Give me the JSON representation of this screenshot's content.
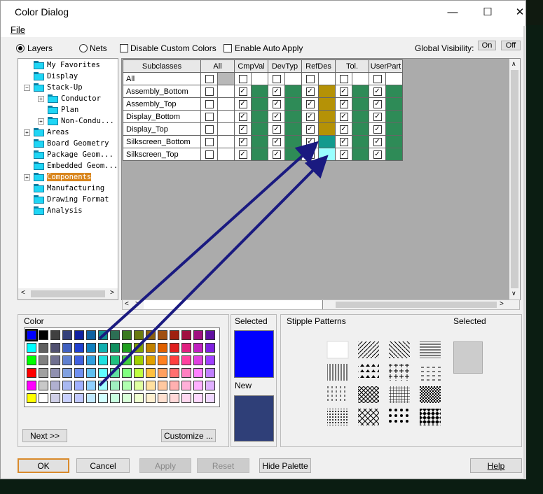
{
  "window": {
    "title": "Color Dialog",
    "minimize": "—",
    "maximize": "☐",
    "close": "✕"
  },
  "menu": {
    "file": "File"
  },
  "options": {
    "layers": "Layers",
    "nets": "Nets",
    "disable_custom": "Disable Custom Colors",
    "enable_auto": "Enable Auto Apply",
    "global_visibility": "Global Visibility:",
    "on": "On",
    "off": "Off"
  },
  "tree": [
    {
      "label": "My Favorites",
      "indent": 0,
      "expander": ""
    },
    {
      "label": "Display",
      "indent": 0,
      "expander": ""
    },
    {
      "label": "Stack-Up",
      "indent": 0,
      "expander": "−"
    },
    {
      "label": "Conductor",
      "indent": 1,
      "expander": "+"
    },
    {
      "label": "Plan",
      "indent": 1,
      "expander": ""
    },
    {
      "label": "Non-Condu...",
      "indent": 1,
      "expander": "+"
    },
    {
      "label": "Areas",
      "indent": 0,
      "expander": "+"
    },
    {
      "label": "Board Geometry",
      "indent": 0,
      "expander": ""
    },
    {
      "label": "Package Geom...",
      "indent": 0,
      "expander": ""
    },
    {
      "label": "Embedded Geom...",
      "indent": 0,
      "expander": ""
    },
    {
      "label": "Components",
      "indent": 0,
      "expander": "+",
      "selected": true
    },
    {
      "label": "Manufacturing",
      "indent": 0,
      "expander": ""
    },
    {
      "label": "Drawing Format",
      "indent": 0,
      "expander": ""
    },
    {
      "label": "Analysis",
      "indent": 0,
      "expander": ""
    }
  ],
  "grid": {
    "columns": [
      "Subclasses",
      "All",
      "CmpVal",
      "DevTyp",
      "RefDes",
      "Tol.",
      "UserPart"
    ],
    "rows": [
      {
        "name": "All",
        "checks": [
          false,
          false,
          false,
          false,
          false,
          false
        ],
        "colors": [
          "#b8b8b8",
          "#ffffff",
          "#ffffff",
          "#ffffff",
          "#ffffff",
          "#ffffff"
        ]
      },
      {
        "name": "Assembly_Bottom",
        "checks": [
          false,
          true,
          true,
          true,
          true,
          true
        ],
        "colors": [
          "#ffffff",
          "#2e8b57",
          "#2e8b57",
          "#b59206",
          "#2e8b57",
          "#2e8b57"
        ]
      },
      {
        "name": "Assembly_Top",
        "checks": [
          false,
          true,
          true,
          true,
          true,
          true
        ],
        "colors": [
          "#ffffff",
          "#2e8b57",
          "#2e8b57",
          "#b59206",
          "#2e8b57",
          "#2e8b57"
        ]
      },
      {
        "name": "Display_Bottom",
        "checks": [
          false,
          true,
          true,
          true,
          true,
          true
        ],
        "colors": [
          "#ffffff",
          "#2e8b57",
          "#2e8b57",
          "#b59206",
          "#2e8b57",
          "#2e8b57"
        ]
      },
      {
        "name": "Display_Top",
        "checks": [
          false,
          true,
          true,
          true,
          true,
          true
        ],
        "colors": [
          "#ffffff",
          "#2e8b57",
          "#2e8b57",
          "#b59206",
          "#2e8b57",
          "#2e8b57"
        ]
      },
      {
        "name": "Silkscreen_Bottom",
        "checks": [
          false,
          true,
          true,
          true,
          true,
          true
        ],
        "colors": [
          "#ffffff",
          "#2e8b57",
          "#2e8b57",
          "#139a8e",
          "#2e8b57",
          "#2e8b57"
        ]
      },
      {
        "name": "Silkscreen_Top",
        "checks": [
          false,
          true,
          true,
          false,
          true,
          true
        ],
        "colors": [
          "#ffffff",
          "#2e8b57",
          "#2e8b57",
          "#99ffff",
          "#2e8b57",
          "#2e8b57"
        ]
      }
    ]
  },
  "palette": {
    "label": "Color",
    "rows": [
      [
        "#0000ff",
        "#000000",
        "#404040",
        "#34407a",
        "#1020a0",
        "#1060a0",
        "#109090",
        "#2c6e54",
        "#3a7a20",
        "#6a7a10",
        "#8a6010",
        "#a05010",
        "#a02010",
        "#a01040",
        "#a01080",
        "#6010a0"
      ],
      [
        "#00ffff",
        "#606060",
        "#505070",
        "#4060c0",
        "#2040d0",
        "#1080c0",
        "#10b0b0",
        "#109060",
        "#20a020",
        "#80a000",
        "#c08000",
        "#e06000",
        "#e02020",
        "#e02080",
        "#c020c0",
        "#8020e0"
      ],
      [
        "#00ff00",
        "#808080",
        "#707090",
        "#6080d0",
        "#4060e0",
        "#30a0e0",
        "#20e0e0",
        "#20c080",
        "#40d040",
        "#a0d000",
        "#e0a000",
        "#ff8020",
        "#ff4040",
        "#ff40a0",
        "#e040e0",
        "#a040ff"
      ],
      [
        "#ff0000",
        "#a0a0a0",
        "#9090b0",
        "#80a0e0",
        "#7090f0",
        "#60c0f0",
        "#60ffff",
        "#60e0a0",
        "#80ff80",
        "#c0ff40",
        "#ffc040",
        "#ffa060",
        "#ff7070",
        "#ff80c0",
        "#ff80ff",
        "#c080ff"
      ],
      [
        "#ff00ff",
        "#c8c8c8",
        "#b0b0d0",
        "#a8b8f0",
        "#a0b0ff",
        "#90d0ff",
        "#a0ffff",
        "#a0f0c0",
        "#b0ffb0",
        "#e0ffa0",
        "#ffe0a0",
        "#ffc8a0",
        "#ffb0b0",
        "#ffb0d8",
        "#ffb0ff",
        "#e0b0ff"
      ],
      [
        "#ffff00",
        "#ffffff",
        "#d0d0e8",
        "#c8d0ff",
        "#c0c8ff",
        "#c0e8ff",
        "#d0ffff",
        "#c8ffe0",
        "#d8ffd8",
        "#f0ffd0",
        "#fff0d0",
        "#ffe0d0",
        "#ffd8d8",
        "#ffd8f0",
        "#ffd8ff",
        "#f0d8ff"
      ]
    ],
    "next": "Next >>",
    "customize": "Customize ..."
  },
  "selected_panel": {
    "selected": "Selected",
    "selected_color": "#0000ff",
    "new": "New",
    "new_color": "#2f3f78"
  },
  "stipple": {
    "label": "Stipple Patterns",
    "selected": "Selected",
    "selected_color": "#cccccc"
  },
  "buttons": {
    "ok": "OK",
    "cancel": "Cancel",
    "apply": "Apply",
    "reset": "Reset",
    "hide_palette": "Hide Palette",
    "help": "Help"
  },
  "arrow_color": "#1a1a80"
}
